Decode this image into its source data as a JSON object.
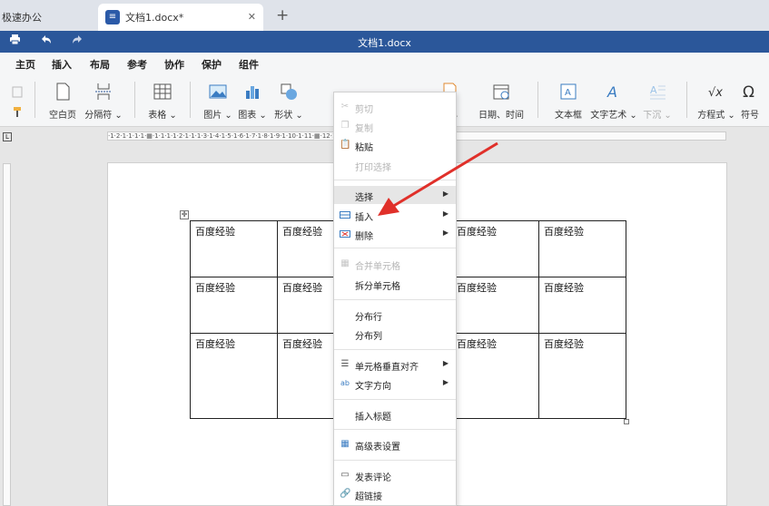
{
  "tabs": {
    "other_label": "极速办公",
    "doc_label": "文档1.docx*",
    "close_glyph": "✕",
    "new_glyph": "+"
  },
  "titlebar": {
    "title": "文档1.docx"
  },
  "menu": {
    "items": [
      {
        "label": "主页"
      },
      {
        "label": "插入"
      },
      {
        "label": "布局"
      },
      {
        "label": "参考"
      },
      {
        "label": "协作"
      },
      {
        "label": "保护"
      },
      {
        "label": "组件"
      }
    ],
    "active": "插入"
  },
  "ribbon": {
    "blank_page": "空白页",
    "page_break": "分隔符 ⌄",
    "table": "表格 ⌄",
    "image": "图片 ⌄",
    "chart": "图表 ⌄",
    "shape": "形状 ⌄",
    "header_footer": "眉 ⌄",
    "date_time": "日期、时间",
    "text_box": "文本框",
    "word_art": "文字艺术 ⌄",
    "drop_cap": "下沉 ⌄",
    "equation": "方程式 ⌄",
    "symbol": "符号"
  },
  "ruler": {
    "top_text": "·1·2·1·1·1·1·▦·1·1·1·1·2·1·1·1·3·1·4·1·5·1·6·1·7·1·8·1·9·1·10·1·11·▦·12·1·13·1·14·▦·15·1·16·1·17·1·",
    "corner": "L"
  },
  "table": {
    "rows": [
      [
        "百度经验",
        "百度经验",
        "",
        "百度经验",
        "百度经验"
      ],
      [
        "百度经验",
        "百度经验",
        "",
        "百度经验",
        "百度经验"
      ],
      [
        "百度经验",
        "百度经验",
        "",
        "百度经验",
        "百度经验"
      ]
    ]
  },
  "context_menu": {
    "cut": "剪切",
    "copy": "复制",
    "paste": "粘贴",
    "print_selection": "打印选择",
    "select": "选择",
    "insert": "插入",
    "delete": "删除",
    "merge_cells": "合并单元格",
    "split_cell": "拆分单元格",
    "distribute_rows": "分布行",
    "distribute_cols": "分布列",
    "cell_valign": "单元格垂直对齐",
    "text_direction": "文字方向",
    "insert_caption": "插入标题",
    "advanced_table": "高级表设置",
    "add_comment": "发表评论",
    "hyperlink": "超链接"
  },
  "icons": {
    "print": "print-icon",
    "undo": "undo-icon",
    "redo": "redo-icon"
  },
  "colors": {
    "title_bar": "#2b579a",
    "arrow": "#e0302a"
  }
}
